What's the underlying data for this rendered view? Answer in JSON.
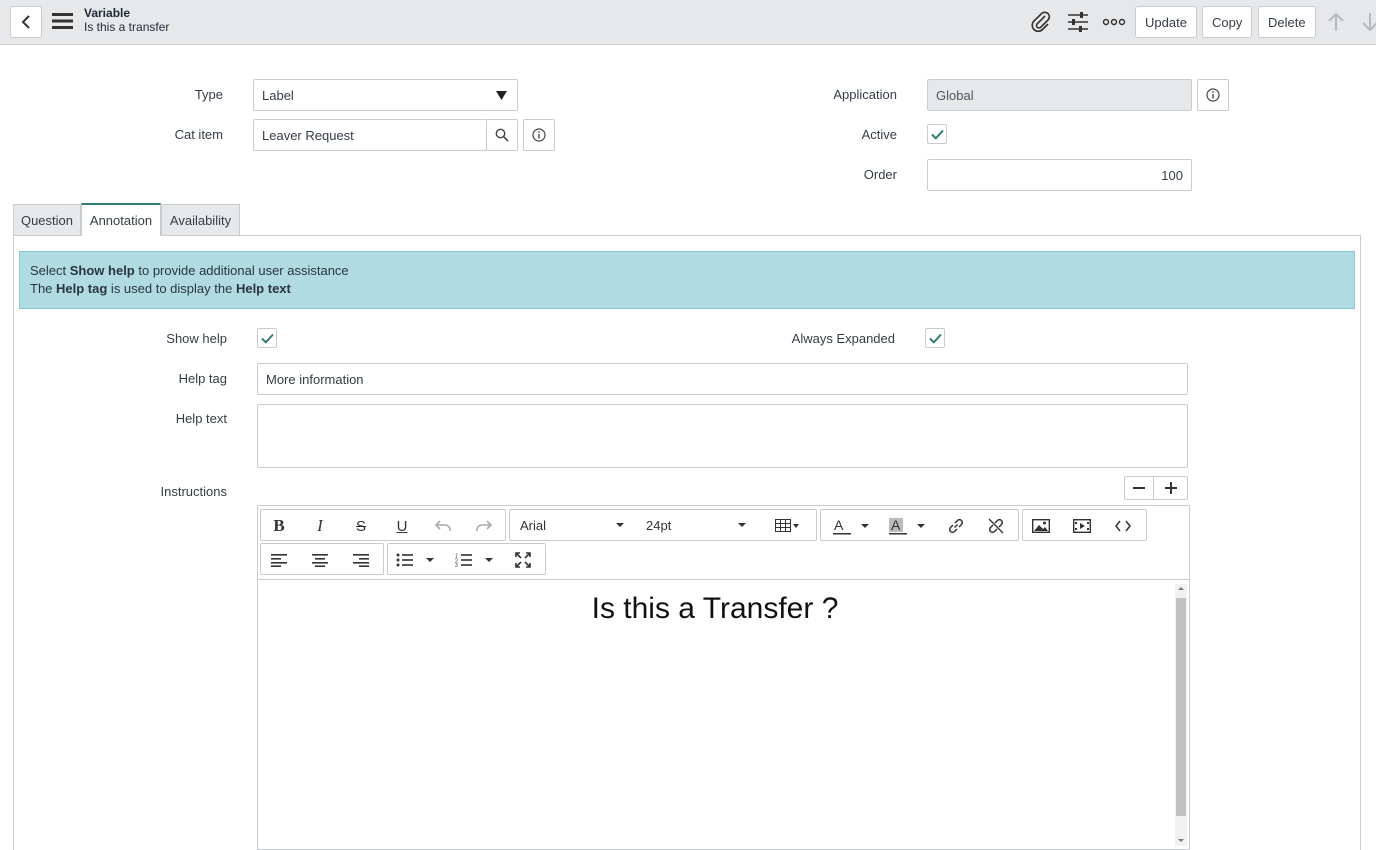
{
  "header": {
    "title": "Variable",
    "subtitle": "Is this a transfer",
    "buttons": {
      "update": "Update",
      "copy": "Copy",
      "delete": "Delete"
    }
  },
  "form": {
    "type": {
      "label": "Type",
      "value": "Label"
    },
    "cat_item": {
      "label": "Cat item",
      "value": "Leaver Request"
    },
    "application": {
      "label": "Application",
      "value": "Global"
    },
    "active": {
      "label": "Active",
      "checked": true
    },
    "order": {
      "label": "Order",
      "value": "100"
    }
  },
  "tabs": [
    {
      "label": "Question",
      "active": false
    },
    {
      "label": "Annotation",
      "active": true
    },
    {
      "label": "Availability",
      "active": false
    }
  ],
  "annotation": {
    "info": {
      "line1_pre": "Select ",
      "line1_bold": "Show help",
      "line1_post": " to provide additional user assistance",
      "line2_pre": "The ",
      "line2_bold1": "Help tag",
      "line2_mid": " is used to display the ",
      "line2_bold2": "Help text"
    },
    "show_help": {
      "label": "Show help",
      "checked": true
    },
    "always_expanded": {
      "label": "Always Expanded",
      "checked": true
    },
    "help_tag": {
      "label": "Help tag",
      "value": "More information"
    },
    "help_text": {
      "label": "Help text",
      "value": ""
    },
    "instructions": {
      "label": "Instructions"
    }
  },
  "editor": {
    "font_family": "Arial",
    "font_size": "24pt",
    "content": "Is this a Transfer ?"
  },
  "colors": {
    "accent": "#2e7d6f",
    "info_bg": "#b0dbe2",
    "header_bg": "#e6e8ea"
  }
}
